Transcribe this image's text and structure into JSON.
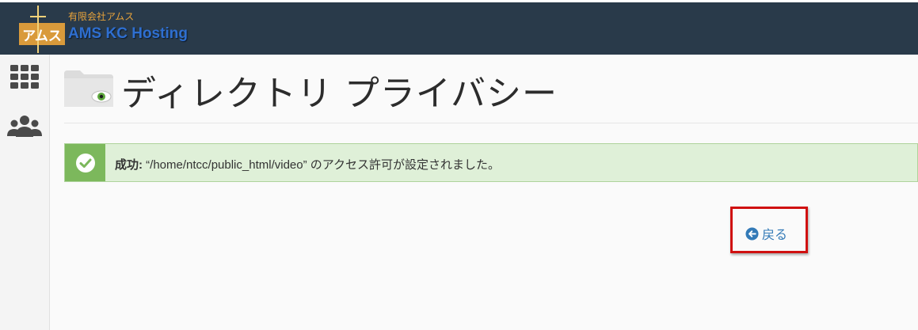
{
  "header": {
    "company_name": "有限会社アムス",
    "product_name": "AMS KC Hosting",
    "logo_text": "アムス"
  },
  "sidebar": {
    "items": [
      {
        "icon": "grid-icon"
      },
      {
        "icon": "users-icon"
      }
    ]
  },
  "page": {
    "title": "ディレクトリ プライバシー",
    "title_icon": "folder-eye-icon"
  },
  "alert": {
    "type": "success",
    "label": "成功:",
    "message": " “/home/ntcc/public_html/video” のアクセス許可が設定されました。"
  },
  "back_link": {
    "label": "戻る",
    "icon": "arrow-left-circle-icon"
  },
  "colors": {
    "topbar": "#293a4a",
    "success_bg": "#dff0d8",
    "success_accent": "#7cb85c",
    "link": "#337ab7",
    "highlight": "#d01010"
  }
}
